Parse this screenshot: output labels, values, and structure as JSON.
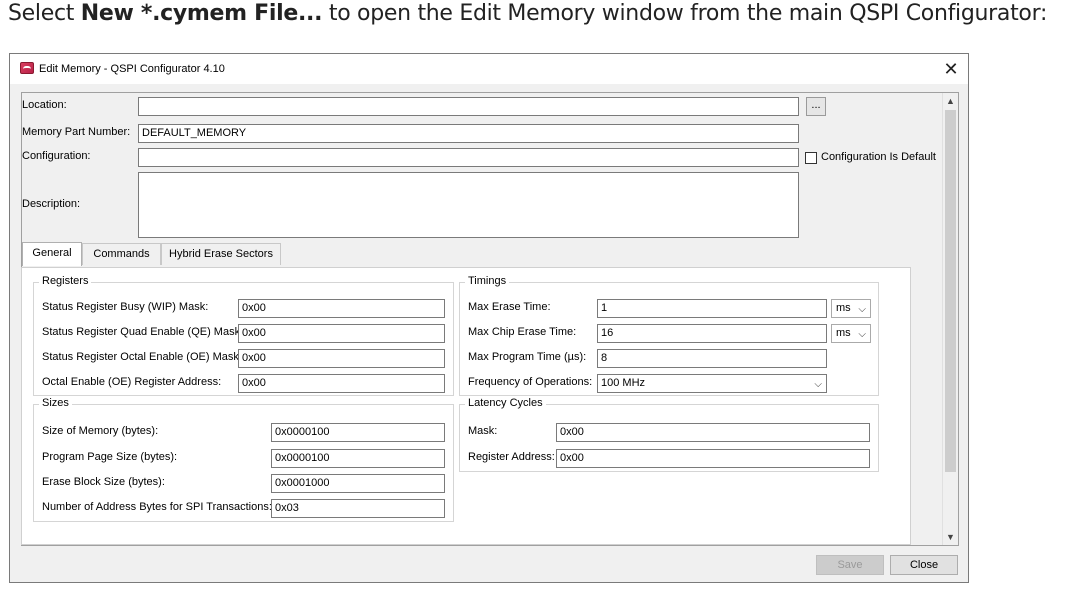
{
  "caption": {
    "prefix": "Select ",
    "bold": "New *.cymem File...",
    "suffix": " to open the Edit Memory window from the main QSPI Configurator:"
  },
  "window": {
    "title": "Edit Memory - QSPI Configurator 4.10",
    "close_glyph": "✕"
  },
  "form": {
    "location_label": "Location:",
    "location_value": "",
    "browse_label": "...",
    "part_number_label": "Memory Part Number:",
    "part_number_value": "DEFAULT_MEMORY",
    "configuration_label": "Configuration:",
    "configuration_value": "",
    "config_default_label": "Configuration Is Default",
    "description_label": "Description:",
    "description_value": ""
  },
  "tabs": [
    "General",
    "Commands",
    "Hybrid Erase Sectors"
  ],
  "registers": {
    "title": "Registers",
    "rows": [
      {
        "label": "Status Register Busy (WIP) Mask:",
        "value": "0x00"
      },
      {
        "label": "Status Register Quad Enable (QE) Mask:",
        "value": "0x00"
      },
      {
        "label": "Status Register Octal Enable (OE) Mask:",
        "value": "0x00"
      },
      {
        "label": "Octal Enable (OE) Register Address:",
        "value": "0x00"
      }
    ]
  },
  "timings": {
    "title": "Timings",
    "max_erase_label": "Max Erase Time:",
    "max_erase_value": "1",
    "max_erase_unit": "ms",
    "max_chip_label": "Max Chip Erase Time:",
    "max_chip_value": "16",
    "max_chip_unit": "ms",
    "max_program_label": "Max Program Time (µs):",
    "max_program_value": "8",
    "frequency_label": "Frequency of Operations:",
    "frequency_value": "100 MHz"
  },
  "sizes": {
    "title": "Sizes",
    "rows": [
      {
        "label": "Size of Memory (bytes):",
        "value": "0x0000100"
      },
      {
        "label": "Program Page Size (bytes):",
        "value": "0x0000100"
      },
      {
        "label": "Erase Block Size (bytes):",
        "value": "0x0001000"
      },
      {
        "label": "Number of Address Bytes for SPI Transactions:",
        "value": "0x03"
      }
    ]
  },
  "latency": {
    "title": "Latency Cycles",
    "mask_label": "Mask:",
    "mask_value": "0x00",
    "register_label": "Register Address:",
    "register_value": "0x00"
  },
  "buttons": {
    "save": "Save",
    "close": "Close"
  }
}
